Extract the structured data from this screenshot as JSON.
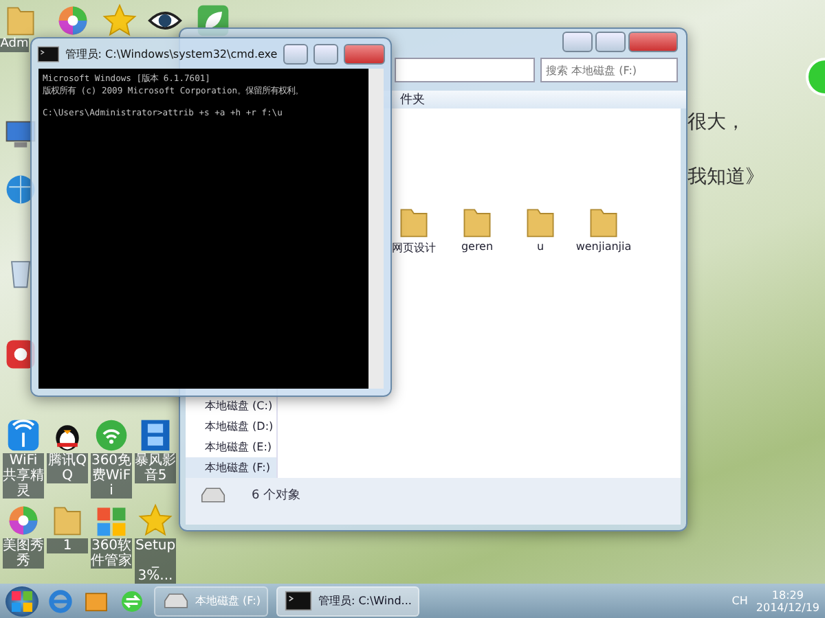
{
  "desktop": {
    "icons": [
      {
        "kind": "folder-user",
        "label": "Adm"
      },
      {
        "kind": "color-wheel"
      },
      {
        "kind": "star"
      },
      {
        "kind": "eye"
      },
      {
        "kind": "leaf"
      },
      {
        "kind": "computer"
      },
      {
        "kind": "network"
      },
      {
        "kind": "recycle"
      },
      {
        "kind": "red-app"
      },
      {
        "kind": "wifi-tower",
        "label": "WiFi共享精灵"
      },
      {
        "kind": "penguin",
        "label": "腾讯QQ"
      },
      {
        "kind": "wifi",
        "label": "360免费WiFi"
      },
      {
        "kind": "film",
        "label": "暴风影音5"
      },
      {
        "kind": "color-wheel",
        "label": "美图秀秀"
      },
      {
        "kind": "folder",
        "label": "1"
      },
      {
        "kind": "app-grid",
        "label": "360软件管家"
      },
      {
        "kind": "star",
        "label": "Setup_3%..."
      }
    ],
    "background_texts": [
      "很大，",
      "我知道》"
    ]
  },
  "explorer": {
    "search": {
      "placeholder": "搜索 本地磁盘 (F:)"
    },
    "toolbar_label": "件夹",
    "folders": [
      "网页设计",
      "geren",
      "u",
      "wenjianjia"
    ],
    "nav_items": [
      {
        "label": "本地磁盘 (C:)",
        "selected": false
      },
      {
        "label": "本地磁盘 (D:)",
        "selected": false
      },
      {
        "label": "本地磁盘 (E:)",
        "selected": false
      },
      {
        "label": "本地磁盘 (F:)",
        "selected": true
      }
    ],
    "status": "6 个对象"
  },
  "cmd": {
    "title": "管理员: C:\\Windows\\system32\\cmd.exe",
    "lines": [
      "Microsoft Windows [版本 6.1.7601]",
      "版权所有 (c) 2009 Microsoft Corporation。保留所有权利。",
      "C:\\Users\\Administrator>attrib +s +a +h +r f:\\u"
    ]
  },
  "taskbar": {
    "tasks": [
      {
        "kind": "drive",
        "label": "本地磁盘 (F:)",
        "selected": false
      },
      {
        "kind": "console",
        "label": "管理员: C:\\Wind...",
        "selected": true
      }
    ],
    "language": "CH",
    "time": "18:29",
    "date": "2014/12/19"
  }
}
